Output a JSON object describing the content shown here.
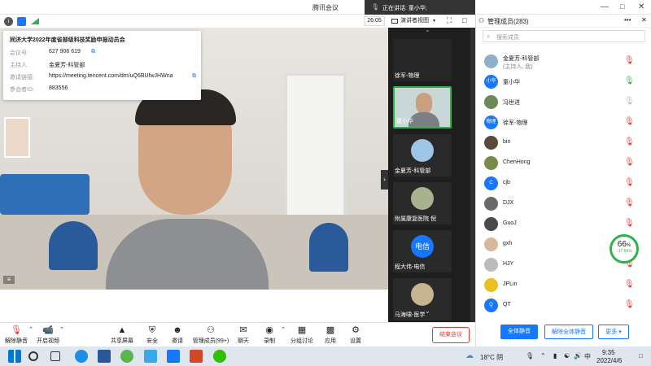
{
  "window": {
    "title": "腾讯会议",
    "speaking_label": "正在讲话: 童小华;"
  },
  "toolbar_top": {
    "timer": "26:05",
    "view_mode": "演讲者视图"
  },
  "meeting_info": {
    "title": "同济大学2022年度省部级科技奖励申报动员会",
    "rows": [
      {
        "label": "会议号:",
        "value": "627 906 619"
      },
      {
        "label": "主持人:",
        "value": "金夏芳-科管部"
      },
      {
        "label": "邀请链接:",
        "value": "https://meeting.tencent.com/dm/uQ6BUfwJHWna"
      },
      {
        "label": "参会者ID:",
        "value": "883556"
      }
    ]
  },
  "filmstrip": [
    {
      "name": "徐军-物理"
    },
    {
      "name": "童小华"
    },
    {
      "name": "金夏芳-科管部"
    },
    {
      "name": "附属康复医院 倪"
    },
    {
      "name": "程大伟-电信",
      "avatar_text": "电信"
    },
    {
      "name": "马海啸-医学"
    }
  ],
  "bottom_toolbar": [
    {
      "label": "解除静音",
      "icon": "mic-muted-icon"
    },
    {
      "label": "开启视频",
      "icon": "camera-off-icon"
    },
    {
      "label": "共享屏幕",
      "icon": "share-screen-icon"
    },
    {
      "label": "安全",
      "icon": "shield-icon"
    },
    {
      "label": "邀请",
      "icon": "invite-icon"
    },
    {
      "label": "管理成员(99+)",
      "icon": "members-icon"
    },
    {
      "label": "聊天",
      "icon": "chat-icon"
    },
    {
      "label": "录制",
      "icon": "record-icon"
    },
    {
      "label": "分组讨论",
      "icon": "breakout-icon"
    },
    {
      "label": "应用",
      "icon": "apps-icon"
    },
    {
      "label": "设置",
      "icon": "gear-icon"
    }
  ],
  "leave_button": "结束会议",
  "panel": {
    "title": "管理成员(283)",
    "search_placeholder": "搜索成员",
    "members": [
      {
        "name": "金夏芳-科管部",
        "sub": "(主持人, 我)",
        "avatar": "",
        "color": "#8fb0c8",
        "mic": "muted"
      },
      {
        "name": "童小华",
        "sub": "",
        "avatar": "小华",
        "color": "#1677ff",
        "mic": "active"
      },
      {
        "name": "冯世进",
        "sub": "",
        "avatar": "",
        "color": "#6a8a5a",
        "mic": "off"
      },
      {
        "name": "徐军-物理",
        "sub": "",
        "avatar": "物理",
        "color": "#1677ff",
        "mic": "muted"
      },
      {
        "name": "bin",
        "sub": "",
        "avatar": "",
        "color": "#5a4a3a",
        "mic": "muted"
      },
      {
        "name": "ChenHong",
        "sub": "",
        "avatar": "",
        "color": "#7a8a4a",
        "mic": "muted"
      },
      {
        "name": "cjb",
        "sub": "",
        "avatar": "C",
        "color": "#1677ff",
        "mic": "muted"
      },
      {
        "name": "DJX",
        "sub": "",
        "avatar": "",
        "color": "#6a6a6a",
        "mic": "muted"
      },
      {
        "name": "GuoJ",
        "sub": "",
        "avatar": "",
        "color": "#4a4a4a",
        "mic": "muted"
      },
      {
        "name": "gxh",
        "sub": "",
        "avatar": "",
        "color": "#d8b89a",
        "mic": "muted"
      },
      {
        "name": "HJY",
        "sub": "",
        "avatar": "",
        "color": "#bbbbbb",
        "mic": "muted"
      },
      {
        "name": "JPLin",
        "sub": "",
        "avatar": "",
        "color": "#e8c020",
        "mic": "muted"
      },
      {
        "name": "QT",
        "sub": "",
        "avatar": "Q",
        "color": "#1677ff",
        "mic": "muted"
      }
    ],
    "mute_all": "全体静音",
    "unmute_all": "解除全体静音",
    "more": "更多"
  },
  "speed_widget": {
    "percent": "66",
    "unit": "%",
    "rate": "↑17.5K/s"
  },
  "taskbar": {
    "weather": "18°C 阴",
    "ime": "中",
    "time": "9:35",
    "date": "2022/4/6"
  },
  "colors": {
    "accent": "#1677ff",
    "danger": "#e33333",
    "muted": "#e33333",
    "active": "#2eb34b"
  }
}
